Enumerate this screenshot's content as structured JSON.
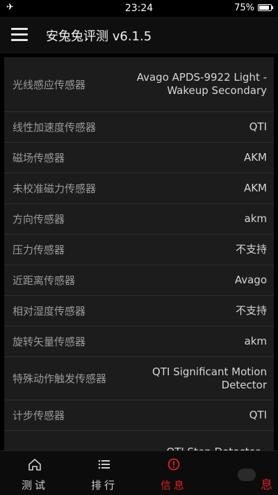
{
  "status": {
    "time": "23:24",
    "battery": "75%",
    "battery_level": 0.75
  },
  "app": {
    "title": "安兔兔评测 v6.1.5"
  },
  "sensors": [
    {
      "label": "光线感应传感器",
      "value": "Avago APDS-9922 Light -Wakeup Secondary"
    },
    {
      "label": "线性加速度传感器",
      "value": "QTI"
    },
    {
      "label": "磁场传感器",
      "value": "AKM"
    },
    {
      "label": "未校准磁力传感器",
      "value": "AKM"
    },
    {
      "label": "方向传感器",
      "value": "akm"
    },
    {
      "label": "压力传感器",
      "value": "不支持"
    },
    {
      "label": "近距离传感器",
      "value": "Avago"
    },
    {
      "label": "相对湿度传感器",
      "value": "不支持"
    },
    {
      "label": "旋转矢量传感器",
      "value": "akm"
    },
    {
      "label": "特殊动作触发传感器",
      "value": "QTI Significant Motion Detector"
    },
    {
      "label": "计步传感器",
      "value": "QTI"
    },
    {
      "label": "",
      "value": "QTI Step Detector -"
    }
  ],
  "nav": {
    "items": [
      {
        "label": "测试",
        "icon": "home-icon"
      },
      {
        "label": "排行",
        "icon": "list-icon"
      },
      {
        "label": "信息",
        "icon": "info-icon"
      }
    ],
    "overlay_char": "息"
  },
  "colors": {
    "accent": "#e02020",
    "background": "#000000",
    "card": "#1c1c1c"
  }
}
